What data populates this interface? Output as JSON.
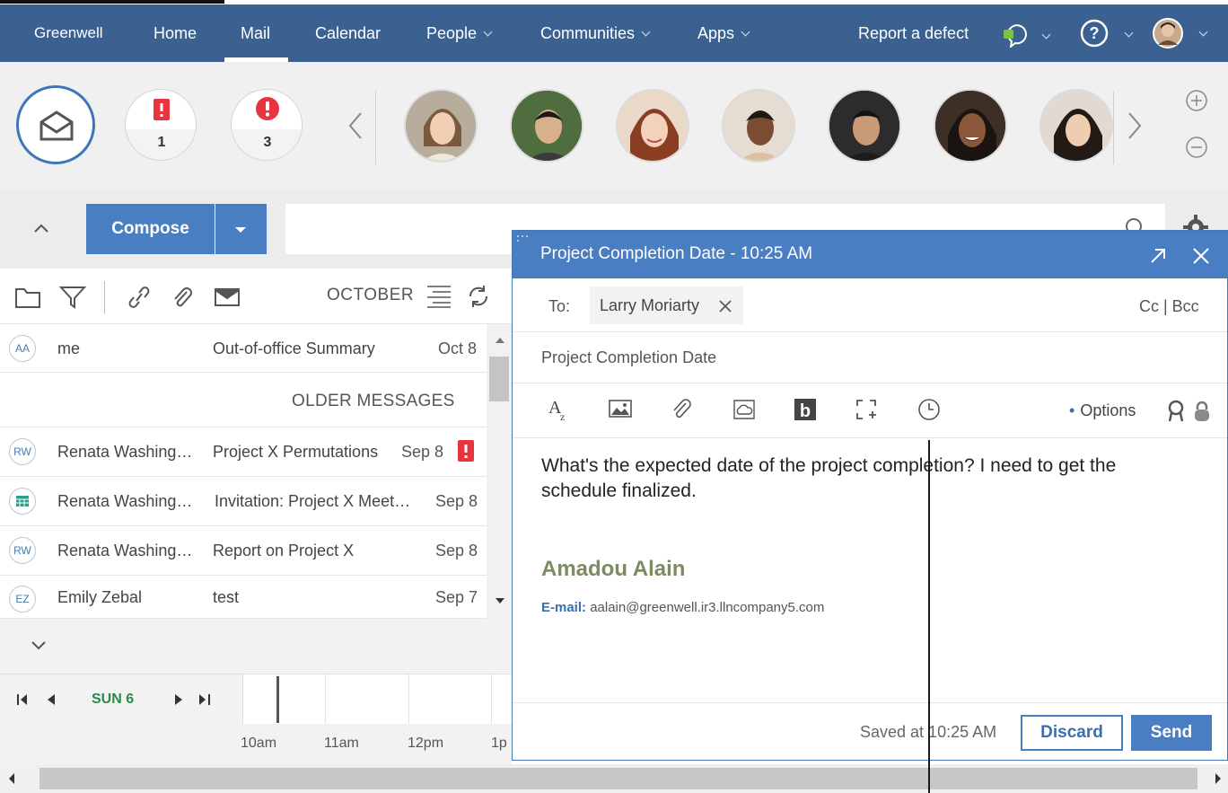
{
  "nav": {
    "brand": "Greenwell",
    "items": [
      "Home",
      "Mail",
      "Calendar",
      "People",
      "Communities",
      "Apps"
    ],
    "report_defect": "Report a defect"
  },
  "shelf": {
    "urgent_count": "1",
    "important_count": "3"
  },
  "compose": {
    "label": "Compose"
  },
  "list": {
    "month": "OCTOBER",
    "older_label": "OLDER MESSAGES",
    "rows": [
      {
        "initials": "AA",
        "sender": "me",
        "subject": "Out-of-office Summary",
        "date": "Oct 8"
      },
      {
        "initials": "RW",
        "sender": "Renata Washing…",
        "subject": "Project X Permutations",
        "date": "Sep 8"
      },
      {
        "initials": "",
        "sender": "Renata Washing…",
        "subject": "Invitation: Project X Meet…",
        "date": "Sep 8"
      },
      {
        "initials": "RW",
        "sender": "Renata Washing…",
        "subject": "Report on Project X",
        "date": "Sep 8"
      },
      {
        "initials": "EZ",
        "sender": "Emily Zebal",
        "subject": "test",
        "date": "Sep 7"
      }
    ]
  },
  "calendar": {
    "day": "SUN 6",
    "times": [
      "10am",
      "11am",
      "12pm",
      "1p"
    ]
  },
  "dialog": {
    "title": "Project Completion Date - 10:25 AM",
    "to_label": "To:",
    "recipient": "Larry Moriarty",
    "cc_bcc": "Cc | Bcc",
    "subject": "Project Completion Date",
    "options": "Options",
    "body_line1": "What's the expected date of the project completion? I need to get the",
    "body_line2": "schedule finalized.",
    "sig_name": "Amadou Alain",
    "sig_email_label": "E-mail:",
    "sig_email": "aalain@greenwell.ir3.llncompany5.com",
    "saved": "Saved at 10:25 AM",
    "discard": "Discard",
    "send": "Send"
  },
  "colors": {
    "nav_bg": "#3a6190",
    "accent": "#4a7ec2",
    "alert": "#e8343c",
    "sig_name": "#7d8a62",
    "cal_day": "#2a8a4a"
  }
}
